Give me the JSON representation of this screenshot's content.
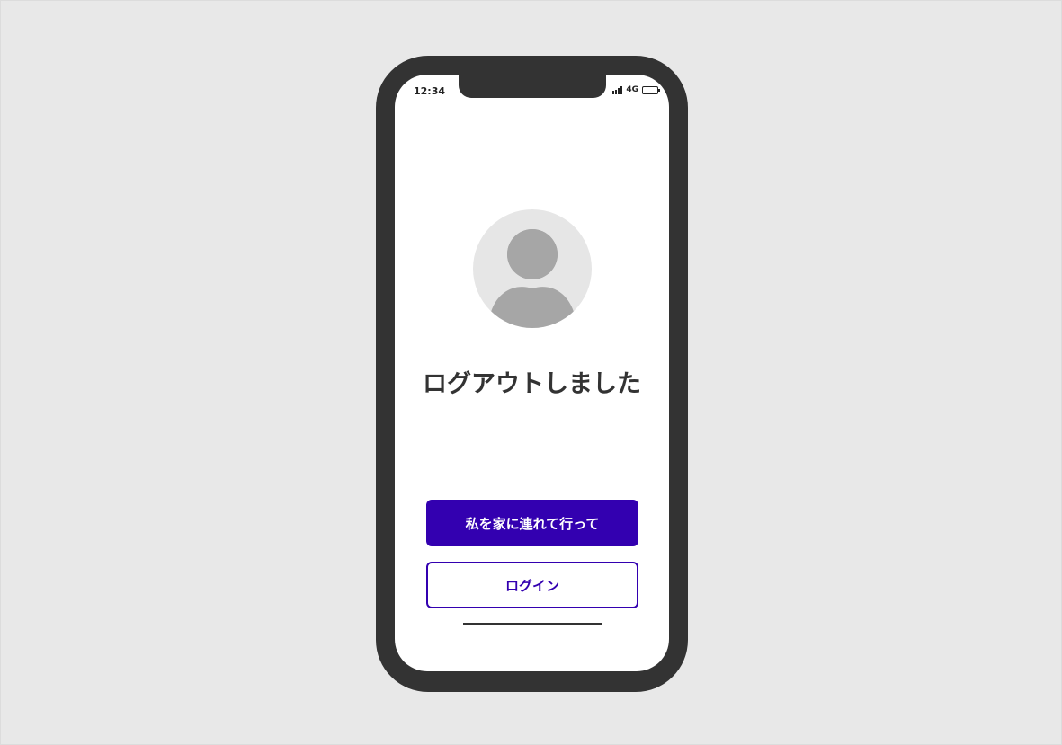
{
  "status_bar": {
    "time": "12:34",
    "network": "4G"
  },
  "main": {
    "title": "ログアウトしました",
    "primary_button": "私を家に連れて行って",
    "secondary_button": "ログイン"
  },
  "colors": {
    "background": "#e8e8e8",
    "device_frame": "#333333",
    "accent": "#3300b0",
    "avatar_bg": "#e6e6e6",
    "avatar_fg": "#a6a6a6"
  },
  "icons": {
    "avatar": "user-avatar-icon",
    "signal": "signal-icon",
    "battery": "battery-icon"
  }
}
